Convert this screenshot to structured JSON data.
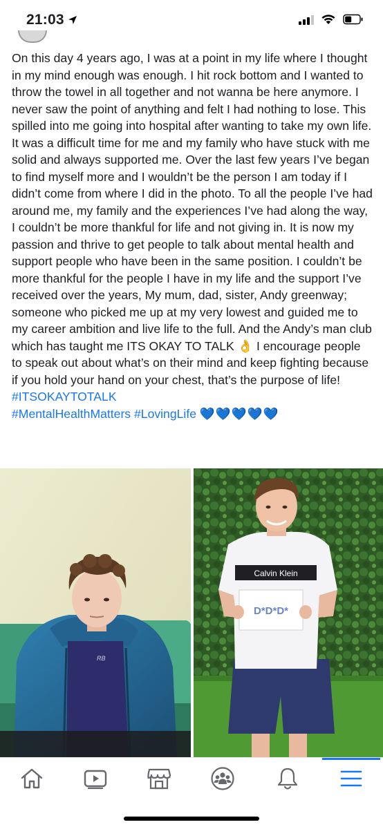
{
  "status_bar": {
    "time": "21:03",
    "location_icon": "location-arrow-icon",
    "signal_icon": "cellular-signal-icon",
    "wifi_icon": "wifi-icon",
    "battery_icon": "battery-icon"
  },
  "post": {
    "text": "On this day 4 years ago, I was at a point in my life where I thought in my mind enough was enough. I hit rock bottom and I wanted to throw the towel in all together and not wanna be here anymore. I never saw the point of anything and felt I had nothing to lose. This spilled into me going into hospital after wanting to take my own life. It was a difficult time for me and my family who have stuck with me solid and always supported me. Over the last few years I’ve began to find myself more and I wouldn’t be the person I am today if I didn’t come from where I did in the photo. To all the people I’ve had around me, my family and the experiences I’ve had along the way, I couldn’t be more thankful for life and not giving in. It is now my passion and thrive to get people to talk about mental health and support people who have been in the same position. I couldn’t be more thankful for the people I have in my life and the support I’ve received over the years, My mum, dad, sister, Andy greenway; someone who picked me up at my very lowest and guided me to my career ambition and live life to the full. And the Andy’s man club which has taught me ITS OKAY TO TALK",
    "emoji_ok": "👌",
    "text_after": " I encourage people to speak out about what’s on their mind and keep fighting because if you hold your hand on your chest, that’s the purpose of life! ",
    "hashtag_1": "#ITSOKAYTOTALK",
    "hashtag_2": "#MentalHealthMatters",
    "hashtag_3": "#LovingLife",
    "hearts": "💙💙💙💙💙"
  },
  "photos": {
    "left": {
      "description_icon": "photo-hospital",
      "shirt_logo": "RB"
    },
    "right": {
      "shirt_brand": "Calvin Klein",
      "sign_text": "D*D*D*"
    }
  },
  "bottom_nav": {
    "items": [
      {
        "icon": "home-icon"
      },
      {
        "icon": "watch-video-icon"
      },
      {
        "icon": "marketplace-icon"
      },
      {
        "icon": "groups-icon"
      },
      {
        "icon": "notifications-bell-icon"
      },
      {
        "icon": "menu-icon"
      }
    ],
    "active_index": 5
  },
  "colors": {
    "accent": "#1877f2",
    "text": "#1c1e21",
    "icon_gray": "#65676b"
  }
}
